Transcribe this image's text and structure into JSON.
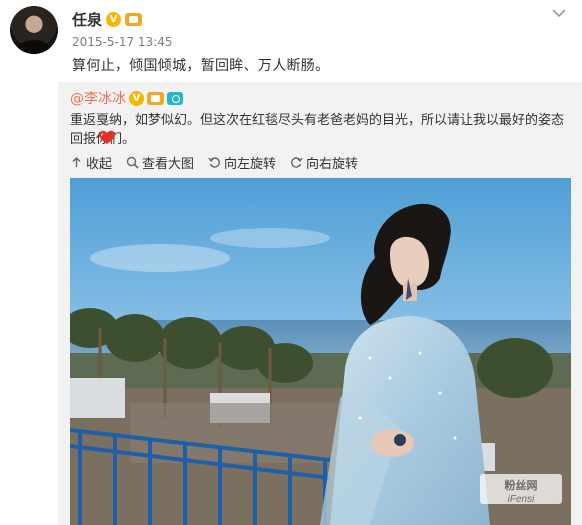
{
  "post": {
    "author_name": "任泉",
    "timestamp": "2015-5-17 13:45",
    "text": "算何止，倾国倾城，暂回眸、万人断肠。",
    "verified_badge": "V",
    "more_icon": "chevron-down-icon"
  },
  "repost": {
    "author_name": "@李冰冰",
    "verified_badge": "V",
    "text": "重返戛纳，如梦似幻。但这次在红毯尽头有老爸老妈的目光，所以请让我以最好的姿态回报你们。",
    "emoji": "heart-emoji",
    "actions": [
      {
        "label": "收起",
        "icon": "collapse-arrow-icon"
      },
      {
        "label": "查看大图",
        "icon": "magnify-icon"
      },
      {
        "label": "向左旋转",
        "icon": "rotate-left-icon"
      },
      {
        "label": "向右旋转",
        "icon": "rotate-right-icon"
      }
    ],
    "photo": {
      "subject": "woman in sparkling blue gown on balcony overlooking the sea and palm trees",
      "watermark": "粉丝网 iFensi"
    }
  },
  "colors": {
    "accent_link": "#eb7350",
    "repost_bg": "#f2f2f2",
    "badge_gold": "#f7b500"
  }
}
